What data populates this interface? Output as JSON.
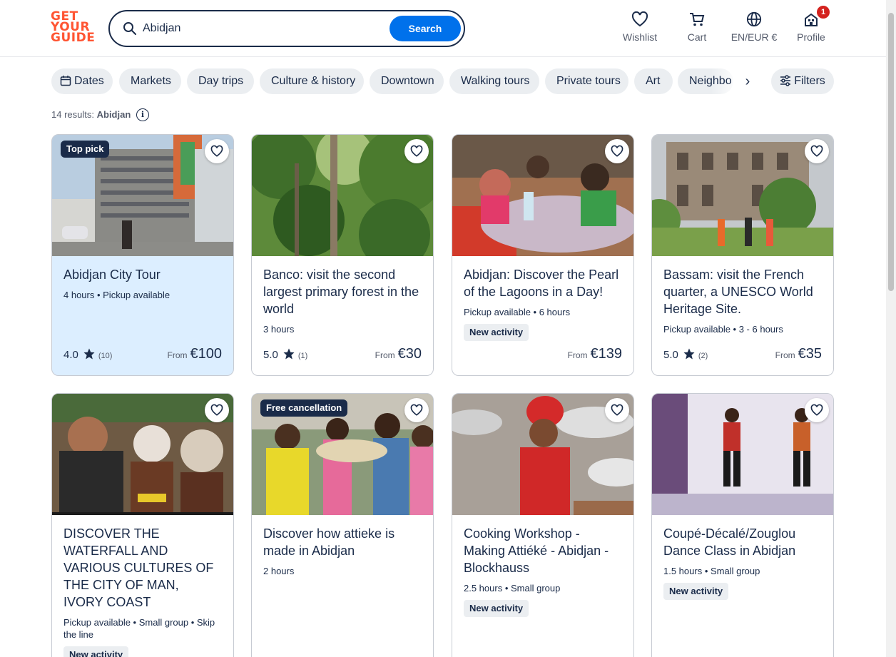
{
  "header": {
    "logo_lines": [
      "GET",
      "YOUR",
      "GUIDE"
    ],
    "search": {
      "value": "Abidjan",
      "button_label": "Search"
    },
    "nav": {
      "wishlist": "Wishlist",
      "cart": "Cart",
      "language": "EN/EUR €",
      "profile": "Profile",
      "profile_badge": "1"
    }
  },
  "filters": {
    "chips": [
      "Dates",
      "Markets",
      "Day trips",
      "Culture & history",
      "Downtown",
      "Walking tours",
      "Private tours",
      "Art",
      "Neighbo"
    ],
    "filters_label": "Filters",
    "scroll_right": "›"
  },
  "results": {
    "count_text": "14 results:",
    "query": "Abidjan",
    "info": "i"
  },
  "cards": [
    {
      "title": "Abidjan City Tour",
      "meta": "4 hours • Pickup available",
      "rating": "4.0",
      "reviews": "(10)",
      "from": "From",
      "price": "€100",
      "tag": "Top pick",
      "new": ""
    },
    {
      "title": "Banco: visit the second largest primary forest in the world",
      "meta": "3 hours",
      "rating": "5.0",
      "reviews": "(1)",
      "from": "From",
      "price": "€30",
      "tag": "",
      "new": ""
    },
    {
      "title": "Abidjan: Discover the Pearl of the Lagoons in a Day!",
      "meta": "Pickup available • 6 hours",
      "rating": "",
      "reviews": "",
      "from": "From",
      "price": "€139",
      "tag": "",
      "new": "New activity"
    },
    {
      "title": "Bassam: visit the French quarter, a UNESCO World Heritage Site.",
      "meta": "Pickup available • 3 - 6 hours",
      "rating": "5.0",
      "reviews": "(2)",
      "from": "From",
      "price": "€35",
      "tag": "",
      "new": ""
    },
    {
      "title": "DISCOVER THE WATERFALL AND VARIOUS CULTURES OF THE CITY OF MAN, IVORY COAST",
      "meta": "Pickup available • Small group • Skip the line",
      "tag": "",
      "new": "New activity"
    },
    {
      "title": "Discover how attieke is made in Abidjan",
      "meta": "2 hours",
      "tag": "Free cancellation",
      "new": ""
    },
    {
      "title": "Cooking Workshop - Making Attiéké - Abidjan - Blockhauss",
      "meta": "2.5 hours • Small group",
      "tag": "",
      "new": "New activity"
    },
    {
      "title": "Coupé-Décalé/Zouglou Dance Class in Abidjan",
      "meta": "1.5 hours • Small group",
      "tag": "",
      "new": "New activity"
    }
  ],
  "colors": {
    "brand": "#ff5533",
    "accent": "#0071eb",
    "text": "#1a2b49",
    "highlight": "#dceeff",
    "badge": "#d4221e"
  }
}
